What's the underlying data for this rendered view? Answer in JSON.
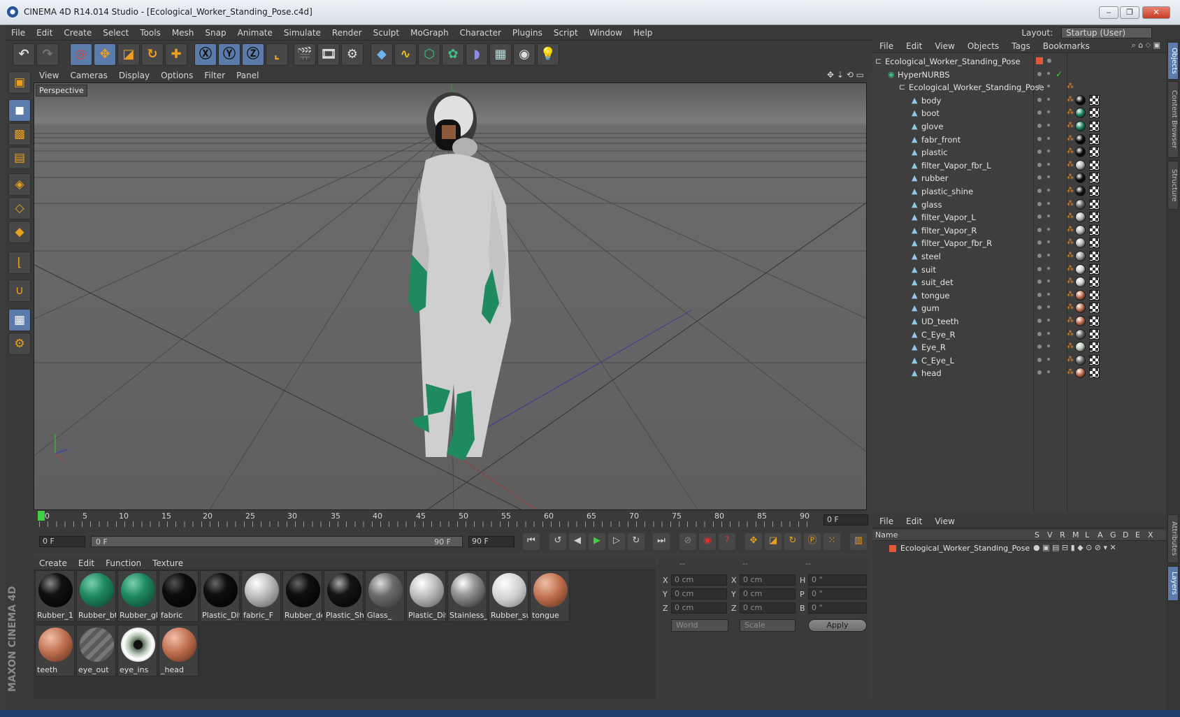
{
  "window": {
    "title": "CINEMA 4D R14.014 Studio - [Ecological_Worker_Standing_Pose.c4d]",
    "min": "‒",
    "max": "❐",
    "close": "✕"
  },
  "menu": [
    "File",
    "Edit",
    "Create",
    "Select",
    "Tools",
    "Mesh",
    "Snap",
    "Animate",
    "Simulate",
    "Render",
    "Sculpt",
    "MoGraph",
    "Character",
    "Plugins",
    "Script",
    "Window",
    "Help"
  ],
  "layout": {
    "label": "Layout:",
    "value": "Startup (User)"
  },
  "viewport": {
    "menu": [
      "View",
      "Cameras",
      "Display",
      "Options",
      "Filter",
      "Panel"
    ],
    "label": "Perspective"
  },
  "timeline": {
    "ticks": [
      "0",
      "5",
      "10",
      "15",
      "20",
      "25",
      "30",
      "35",
      "40",
      "45",
      "50",
      "55",
      "60",
      "65",
      "70",
      "75",
      "80",
      "85",
      "90"
    ],
    "current_frame": "0 F",
    "start": "0 F",
    "range_start": "0 F",
    "range_end": "90 F",
    "end": "90 F"
  },
  "material_manager": {
    "menu": [
      "Create",
      "Edit",
      "Function",
      "Texture"
    ],
    "materials": [
      {
        "label": "Rubber_1",
        "color": "#111111"
      },
      {
        "label": "Rubber_bt",
        "color": "#1f8a62"
      },
      {
        "label": "Rubber_gl",
        "color": "#1f8a62"
      },
      {
        "label": "fabric",
        "color": "#0c0c0c"
      },
      {
        "label": "Plastic_Diff",
        "color": "#0e0e0e"
      },
      {
        "label": "fabric_F",
        "color": "#b8b8b8"
      },
      {
        "label": "Rubber_de",
        "color": "#0e0e0e"
      },
      {
        "label": "Plastic_Shir",
        "color": "#151515"
      },
      {
        "label": "Glass_",
        "color": "#6a6a6a"
      },
      {
        "label": "Plastic_Diff",
        "color": "#b8b8b8"
      },
      {
        "label": "Stainless_S",
        "color": "#9a9a9a"
      },
      {
        "label": "Rubber_su",
        "color": "#cfcfcf"
      },
      {
        "label": "tongue",
        "color": "#c07050"
      },
      {
        "label": "teeth",
        "color": "#c07050"
      },
      {
        "label": "eye_out",
        "color": "#6a6a6a"
      },
      {
        "label": "eye_ins",
        "color": "#b8c8b8"
      },
      {
        "label": "_head",
        "color": "#c07050"
      }
    ]
  },
  "coordinates": {
    "header": [
      "--",
      "--",
      "--"
    ],
    "rows": [
      {
        "a": "X",
        "av": "0 cm",
        "b": "X",
        "bv": "0 cm",
        "c": "H",
        "cv": "0 °"
      },
      {
        "a": "Y",
        "av": "0 cm",
        "b": "Y",
        "bv": "0 cm",
        "c": "P",
        "cv": "0 °"
      },
      {
        "a": "Z",
        "av": "0 cm",
        "b": "Z",
        "bv": "0 cm",
        "c": "B",
        "cv": "0 °"
      }
    ],
    "space": "World",
    "mode": "Scale",
    "apply": "Apply"
  },
  "object_manager": {
    "menu": [
      "File",
      "Edit",
      "View",
      "Objects",
      "Tags",
      "Bookmarks"
    ],
    "root": "Ecological_Worker_Standing_Pose",
    "hypernurbs": "HyperNURBS",
    "group": "Ecological_Worker_Standing_Pose",
    "objects": [
      {
        "name": "body",
        "mat": "#111111"
      },
      {
        "name": "boot",
        "mat": "#1f8a62"
      },
      {
        "name": "glove",
        "mat": "#1f8a62"
      },
      {
        "name": "fabr_front",
        "mat": "#0c0c0c"
      },
      {
        "name": "plastic",
        "mat": "#0e0e0e"
      },
      {
        "name": "filter_Vapor_fbr_L",
        "mat": "#b8b8b8"
      },
      {
        "name": "rubber",
        "mat": "#0e0e0e"
      },
      {
        "name": "plastic_shine",
        "mat": "#151515"
      },
      {
        "name": "glass",
        "mat": "#6a6a6a"
      },
      {
        "name": "filter_Vapor_L",
        "mat": "#b8b8b8"
      },
      {
        "name": "filter_Vapor_R",
        "mat": "#b8b8b8"
      },
      {
        "name": "filter_Vapor_fbr_R",
        "mat": "#b8b8b8"
      },
      {
        "name": "steel",
        "mat": "#9a9a9a"
      },
      {
        "name": "suit",
        "mat": "#cfcfcf"
      },
      {
        "name": "suit_det",
        "mat": "#cfcfcf"
      },
      {
        "name": "tongue",
        "mat": "#c07050"
      },
      {
        "name": "gum",
        "mat": "#c07050"
      },
      {
        "name": "UD_teeth",
        "mat": "#c07050"
      },
      {
        "name": "C_Eye_R",
        "mat": "#6a6a6a"
      },
      {
        "name": "Eye_R",
        "mat": "#b8c8b8"
      },
      {
        "name": "C_Eye_L",
        "mat": "#6a6a6a"
      },
      {
        "name": "head",
        "mat": "#c07050"
      }
    ]
  },
  "layer_manager": {
    "menu": [
      "File",
      "Edit",
      "View"
    ],
    "columns": [
      "Name",
      "S",
      "V",
      "R",
      "M",
      "L",
      "A",
      "G",
      "D",
      "E",
      "X"
    ],
    "row": "Ecological_Worker_Standing_Pose"
  },
  "side_tabs": [
    "Objects",
    "Content Browser",
    "Structure",
    "Attributes",
    "Layers"
  ],
  "brand": "MAXON CINEMA 4D",
  "colors": {
    "accent": "#5b7baa",
    "tag": "#e88a20",
    "root": "#e05a3a"
  }
}
